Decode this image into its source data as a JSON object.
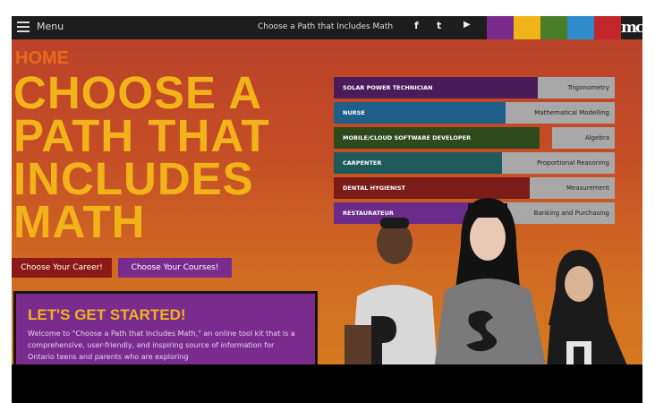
{
  "nav": {
    "menu_label": "Menu",
    "title": "Choose a Path that Includes Math",
    "social": [
      {
        "icon": "facebook-icon",
        "glyph": "f"
      },
      {
        "icon": "twitter-icon",
        "glyph": "t"
      },
      {
        "icon": "youtube-icon",
        "glyph": "▶"
      }
    ],
    "swatch_colors": [
      "#7a2c8e",
      "#f2b21a",
      "#4a7d2a",
      "#2f8bc9",
      "#c0262a"
    ],
    "logo": "mc"
  },
  "page": {
    "label": "HOME",
    "headline_lines": [
      "CHOOSE A",
      "PATH THAT",
      "INCLUDES",
      "MATH"
    ]
  },
  "buttons": {
    "career": "Choose Your Career!",
    "courses": "Choose Your Courses!"
  },
  "get_started": {
    "title": "LET'S GET STARTED!",
    "text": "Welcome to \"Choose a Path that Includes Math,\" an online tool kit that is a comprehensive, user-friendly, and inspiring source of information for Ontario teens and parents who are exploring"
  },
  "careers": [
    {
      "career": "SOLAR POWER TECHNICIAN",
      "subject": "Trigonometry",
      "color": "#4a1d5a"
    },
    {
      "career": "NURSE",
      "subject": "Mathematical Modelling",
      "color": "#1f5f8a"
    },
    {
      "career": "MOBILE/CLOUD SOFTWARE DEVELOPER",
      "subject": "Algebra",
      "color": "#2d4a1c"
    },
    {
      "career": "CARPENTER",
      "subject": "Proportional Reasoning",
      "color": "#1f5a5a"
    },
    {
      "career": "DENTAL HYGIENIST",
      "subject": "Measurement",
      "color": "#7a1c18"
    },
    {
      "career": "RESTAURATEUR",
      "subject": "Banking and Purchasing",
      "color": "#6a2a8a"
    }
  ]
}
